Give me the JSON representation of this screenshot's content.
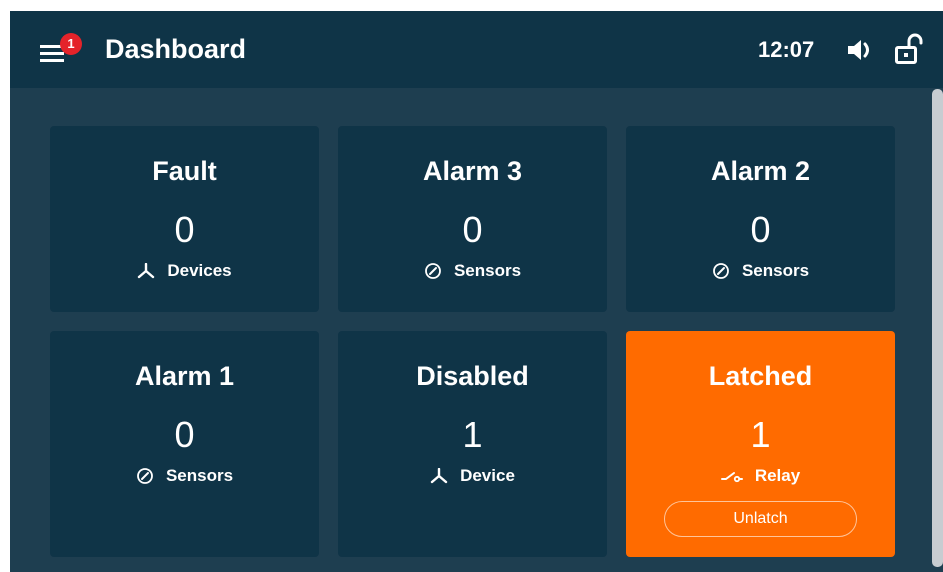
{
  "header": {
    "title": "Dashboard",
    "menu_badge": "1",
    "time": "12:07"
  },
  "cards": [
    {
      "title": "Fault",
      "count": "0",
      "label": "Devices",
      "icon": "device-tree-icon"
    },
    {
      "title": "Alarm 3",
      "count": "0",
      "label": "Sensors",
      "icon": "gauge-icon"
    },
    {
      "title": "Alarm 2",
      "count": "0",
      "label": "Sensors",
      "icon": "gauge-icon"
    },
    {
      "title": "Alarm 1",
      "count": "0",
      "label": "Sensors",
      "icon": "gauge-icon"
    },
    {
      "title": "Disabled",
      "count": "1",
      "label": "Device",
      "icon": "device-tree-icon"
    },
    {
      "title": "Latched",
      "count": "1",
      "label": "Relay",
      "icon": "relay-switch-icon",
      "action_label": "Unlatch"
    }
  ],
  "colors": {
    "header_bg": "#0f3447",
    "body_bg": "#1e3e50",
    "card_bg": "#0f3447",
    "latched_accent": "#ff6b00",
    "badge_red": "#e4232a"
  }
}
